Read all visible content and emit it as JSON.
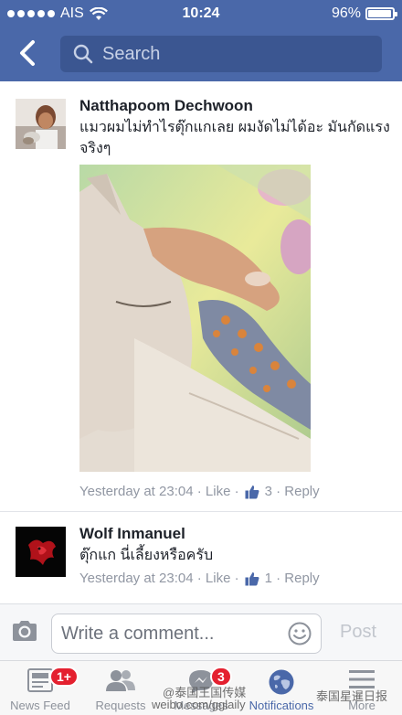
{
  "status_bar": {
    "carrier": "AIS",
    "time": "10:24",
    "battery": "96%"
  },
  "header": {
    "search_placeholder": "Search"
  },
  "comments": [
    {
      "author": "Natthapoom Dechwoon",
      "text": "แมวผมไม่ทำไรตุ๊กแกเลย ผมงัดไม่ได้อะ มันกัดแรง จริงๆ",
      "time": "Yesterday at 23:04",
      "like_label": "Like",
      "like_count": "3",
      "reply_label": "Reply"
    },
    {
      "author": "Wolf Inmanuel",
      "text": "ตุ๊กแก นี่เลี้ยงหรือครับ",
      "time": "Yesterday at 23:04",
      "like_label": "Like",
      "like_count": "1",
      "reply_label": "Reply"
    }
  ],
  "composer": {
    "placeholder": "Write a comment...",
    "post_label": "Post"
  },
  "tabs": [
    {
      "label": "News Feed",
      "icon": "news-feed-icon",
      "badge": "1+"
    },
    {
      "label": "Requests",
      "icon": "friends-icon",
      "badge": ""
    },
    {
      "label": "Messages",
      "icon": "messages-icon",
      "badge": "3"
    },
    {
      "label": "Notifications",
      "icon": "globe-icon",
      "badge": ""
    },
    {
      "label": "More",
      "icon": "menu-icon",
      "badge": ""
    }
  ],
  "watermarks": {
    "weibo_name": "@泰国王国传媒",
    "weibo_url": "weibo.com/gglaily",
    "wechat_name": "泰国星暹日报"
  },
  "colors": {
    "brand_blue": "#4a68a9",
    "badge_red": "#e4202f",
    "meta_gray": "#9197a3"
  }
}
